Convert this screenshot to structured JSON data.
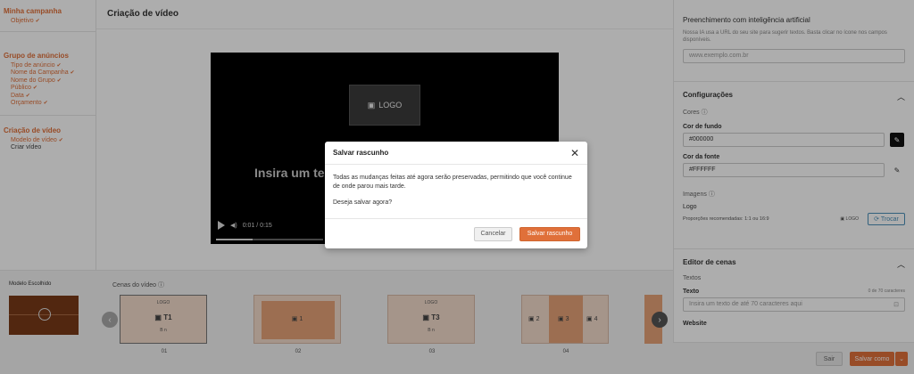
{
  "sidebar": {
    "sections": [
      {
        "title": "Minha campanha",
        "items": [
          {
            "label": "Objetivo",
            "done": true
          }
        ]
      },
      {
        "title": "Grupo de anúncios",
        "items": [
          {
            "label": "Tipo de anúncio",
            "done": true
          },
          {
            "label": "Nome da Campanha",
            "done": true
          },
          {
            "label": "Nome do Grupo",
            "done": true
          },
          {
            "label": "Público",
            "done": true
          },
          {
            "label": "Data",
            "done": true
          },
          {
            "label": "Orçamento",
            "done": true
          }
        ]
      },
      {
        "title": "Criação de vídeo",
        "items": [
          {
            "label": "Modelo de vídeo",
            "done": true
          },
          {
            "label": "Criar vídeo",
            "done": false
          }
        ]
      }
    ],
    "check_glyph": "✔"
  },
  "main": {
    "title": "Criação de vídeo",
    "player": {
      "logo_label": "LOGO",
      "text_preview": "Insira um te",
      "time": "0:01 / 0:15",
      "progress_fraction": 0.34
    },
    "chosen_model_label": "Modelo Escolhido",
    "scenes_label": "Cenas do vídeo",
    "scenes": [
      {
        "number": "01",
        "caption_top": "LOGO",
        "caption_main": "T1",
        "caption_bottom": "B n"
      },
      {
        "number": "02",
        "caption_main": "1"
      },
      {
        "number": "03",
        "caption_top": "LOGO",
        "caption_main": "T3",
        "caption_bottom": "B n"
      },
      {
        "number": "04",
        "captions": [
          "2",
          "3",
          "4"
        ]
      }
    ]
  },
  "right_panel": {
    "ai_title": "Preenchimento com inteligência artificial",
    "ai_note": "Nossa IA usa a URL do seu site para sugerir textos. Basta clicar no ícone nos campos disponíveis.",
    "url_placeholder": "www.exemplo.com.br",
    "config_title": "Configurações",
    "colors_label": "Cores",
    "bg_label": "Cor de fundo",
    "bg_value": "#000000",
    "font_label": "Cor da fonte",
    "font_value": "#FFFFFF",
    "images_label": "Imagens",
    "logo_label": "Logo",
    "logo_hint": "Proporções recomendadas: 1:1 ou 16:9",
    "logo_thumb": "LOGO",
    "swap_label": "Trocar",
    "scenes_editor_title": "Editor de cenas",
    "texts_label": "Textos",
    "text_field_label": "Texto",
    "text_counter": "0 de 70 caracteres",
    "text_placeholder": "Insira um texto de até 70 caracteres aqui",
    "website_label": "Website",
    "exit_label": "Sair",
    "save_label": "Salvar como"
  },
  "modal": {
    "title": "Salvar rascunho",
    "body_line1": "Todas as mudanças feitas até agora serão preservadas, permitindo que você continue de onde parou mais tarde.",
    "body_line2": "Deseja salvar agora?",
    "cancel": "Cancelar",
    "confirm": "Salvar rascunho"
  },
  "colors": {
    "accent": "#e0703a"
  }
}
